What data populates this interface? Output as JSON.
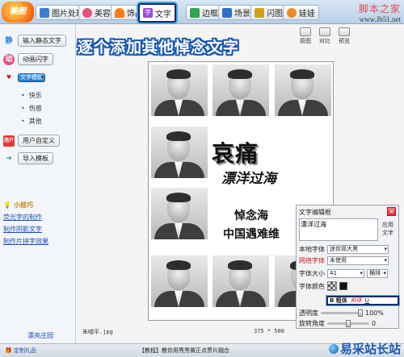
{
  "app": {
    "logo_text": "美图"
  },
  "site": {
    "brand": "脚本之家",
    "url": "www.Jb51.net"
  },
  "tabs": [
    {
      "label": "图片处理",
      "icon": "photo-icon",
      "color": "#3c7fd0"
    },
    {
      "label": "美容",
      "icon": "face-icon",
      "color": "#e2527a"
    },
    {
      "label": "饰品",
      "icon": "heart-icon",
      "color": "#ff7a1a"
    },
    {
      "label": "文字",
      "icon": "text-icon",
      "color": "#9a4be0"
    },
    {
      "label": "边框",
      "icon": "frame-icon",
      "color": "#2fa54f"
    },
    {
      "label": "场景",
      "icon": "scene-icon",
      "color": "#2f6fd0"
    },
    {
      "label": "闪图",
      "icon": "flash-icon",
      "color": "#d1a11c"
    },
    {
      "label": "娃娃",
      "icon": "doll-icon",
      "color": "#f08a24"
    }
  ],
  "banner": "逐个添加其他悼念文字",
  "toolbar": {
    "orig": "原图",
    "compare": "对比",
    "preview": "预览"
  },
  "sidebar": {
    "static_text": "输入静态文字",
    "anim_text": "动画闪字",
    "template": "文字模板",
    "sub_items": [
      "快乐",
      "伤感",
      "其他"
    ],
    "custom": "用户自定义",
    "import": "导入模板",
    "tips_title": "小技巧",
    "tips_links": [
      "荧光字的制作",
      "制作阴影文字",
      "制作片拼字效果"
    ],
    "garden": "漂亮庄园"
  },
  "poster": {
    "title": "哀痛",
    "subtitle": "漂洋过海",
    "line1": "悼念海",
    "line2": "中国遇难维"
  },
  "panel": {
    "title": "文字编辑框",
    "text_value": "漂洋过海",
    "apply": "应用文字",
    "font_label": "本地字体",
    "font_value": "迷你简大黑",
    "net_font_label": "网络字体",
    "net_font_value": "未使用",
    "size_label": "字体大小",
    "size_value": "41",
    "direction_value": "横排",
    "color_label": "字体颜色",
    "color_value": "#111111",
    "bold": "B 粗体",
    "italic": "斜体",
    "underline": "U",
    "opacity_label": "透明度",
    "opacity_value": "100%",
    "rotate_label": "旋转角度",
    "rotate_value": "0"
  },
  "canvas": {
    "filename": "朱嘘平.jpg",
    "dims": "375 * 500"
  },
  "status": {
    "left": "定制礼品",
    "middle": "【教程】教你用秀秀做正点票片融合",
    "brand": "易采站长站"
  }
}
